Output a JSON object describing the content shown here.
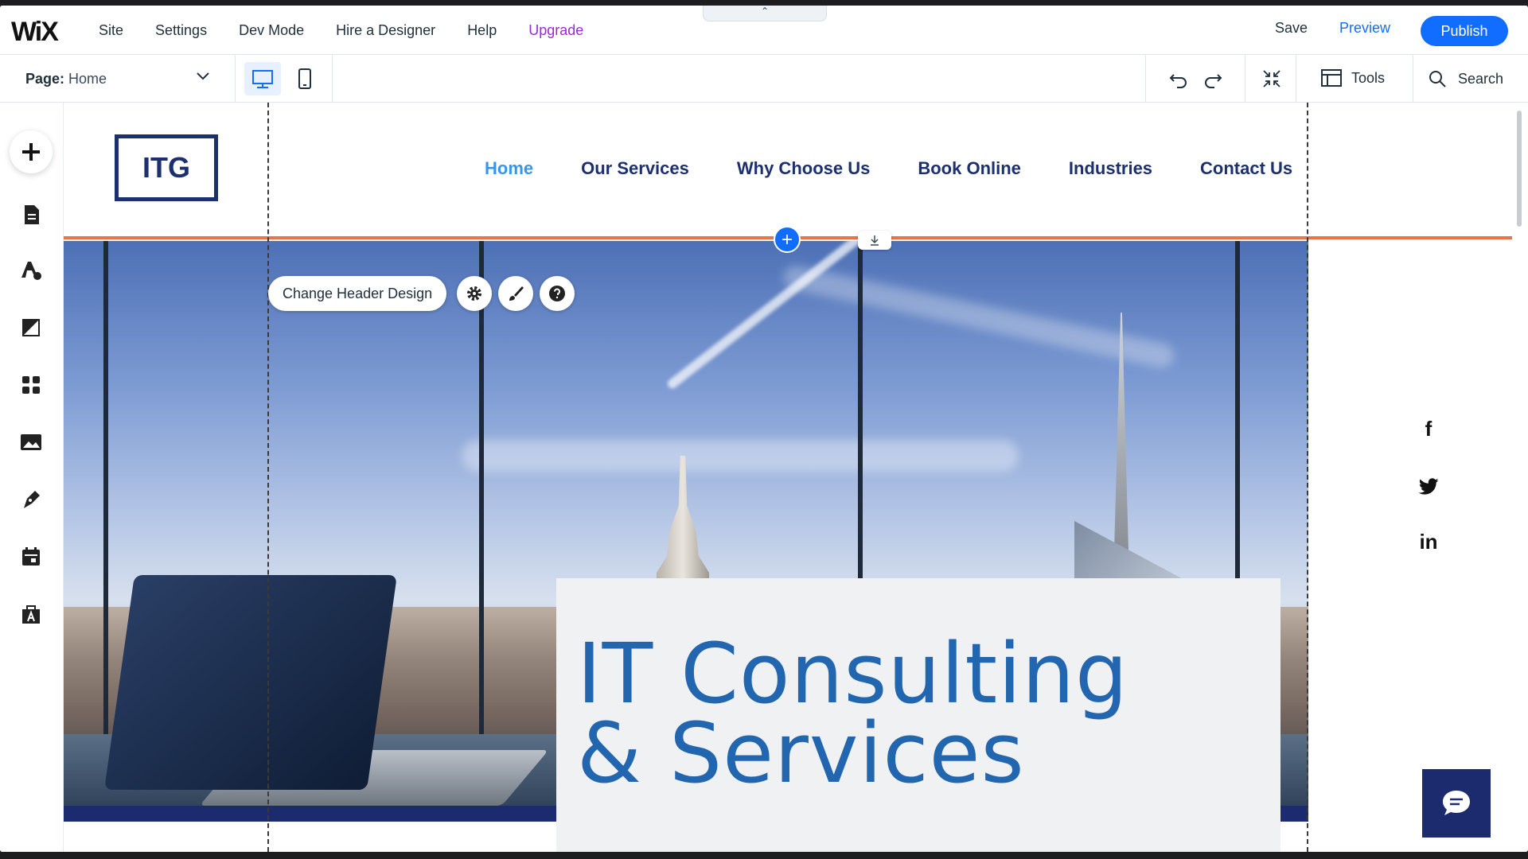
{
  "editor": {
    "logo": "WiX",
    "menu": [
      "Site",
      "Settings",
      "Dev Mode",
      "Hire a Designer",
      "Help",
      "Upgrade"
    ],
    "collapse_icon": "chevron-up-icon",
    "save_label": "Save",
    "preview_label": "Preview",
    "publish_label": "Publish",
    "accent_color": "#116dff",
    "upgrade_color": "#9a27d5"
  },
  "subbar": {
    "page_prefix": "Page:",
    "page_name": "Home",
    "tools_label": "Tools",
    "search_label": "Search"
  },
  "sidebar_icons": [
    "add-icon",
    "pages-icon",
    "design-icon",
    "background-icon",
    "apps-icon",
    "media-icon",
    "blog-icon",
    "bookings-icon",
    "portfolio-icon"
  ],
  "site": {
    "logo_text": "ITG",
    "nav": [
      "Home",
      "Our Services",
      "Why Choose Us",
      "Book Online",
      "Industries",
      "Contact Us"
    ],
    "active_nav": "Home",
    "hero_title": "IT Consulting\n& Services",
    "social": [
      "f",
      "in"
    ],
    "primary_color": "#1c2f6e",
    "title_color": "#2266b0"
  },
  "header_toolbar": {
    "change_design_label": "Change Header Design"
  }
}
